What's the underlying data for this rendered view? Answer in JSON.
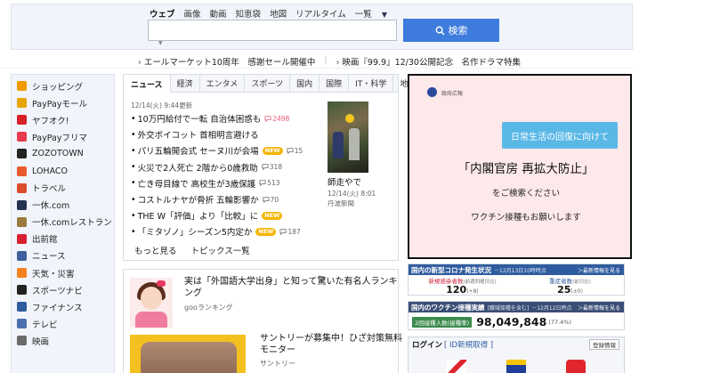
{
  "search": {
    "tabs": [
      "ウェブ",
      "画像",
      "動画",
      "知恵袋",
      "地図",
      "リアルタイム",
      "一覧"
    ],
    "button_label": "検索",
    "input_value": "",
    "input_placeholder": ""
  },
  "promos": [
    "エールマーケット10周年　感謝セール開催中",
    "映画『99.9』12/30公開記念　名作ドラマ特集"
  ],
  "sidebar": {
    "items": [
      {
        "label": "ショッピング",
        "icon": "cart-icon",
        "color": "#f39a00"
      },
      {
        "label": "PayPayモール",
        "icon": "bag-icon",
        "color": "#e8a400"
      },
      {
        "label": "ヤフオク!",
        "icon": "hammer-icon",
        "color": "#d92027"
      },
      {
        "label": "PayPayフリマ",
        "icon": "tag-icon",
        "color": "#e73a4e"
      },
      {
        "label": "ZOZOTOWN",
        "icon": "zozo-icon",
        "color": "#222222"
      },
      {
        "label": "LOHACO",
        "icon": "lohaco-icon",
        "color": "#e85a2e"
      },
      {
        "label": "トラベル",
        "icon": "suitcase-icon",
        "color": "#d94c2c"
      },
      {
        "label": "一休.com",
        "icon": "ikyu-icon",
        "color": "#24334f"
      },
      {
        "label": "一休.comレストラン",
        "icon": "restaurant-icon",
        "color": "#9b7b3d"
      },
      {
        "label": "出前館",
        "icon": "delivery-icon",
        "color": "#d81f30"
      },
      {
        "label": "ニュース",
        "icon": "news-icon",
        "color": "#3f5f9e"
      },
      {
        "label": "天気・災害",
        "icon": "weather-icon",
        "color": "#f58220"
      },
      {
        "label": "スポーツナビ",
        "icon": "sports-icon",
        "color": "#222222"
      },
      {
        "label": "ファイナンス",
        "icon": "finance-icon",
        "color": "#2f5c9e"
      },
      {
        "label": "テレビ",
        "icon": "tv-icon",
        "color": "#4a6fb0"
      },
      {
        "label": "映画",
        "icon": "movie-icon",
        "color": "#6b6b6b"
      }
    ]
  },
  "news": {
    "tabs": [
      "ニュース",
      "経済",
      "エンタメ",
      "スポーツ",
      "国内",
      "国際",
      "IT・科学",
      "地域"
    ],
    "timestamp": "12/14(火) 9:44更新",
    "items": [
      {
        "text": "10万円給付で一転 自治体困惑も",
        "comments": "2498",
        "hot": true,
        "new": false
      },
      {
        "text": "外交ボイコット 首相明言避ける",
        "comments": "",
        "hot": false,
        "new": false
      },
      {
        "text": "パリ五輪開会式 セーヌ川が会場",
        "comments": "15",
        "hot": false,
        "new": true
      },
      {
        "text": "火災で2人死亡 2階から0歳救助",
        "comments": "318",
        "hot": false,
        "new": false
      },
      {
        "text": "亡き母目線で 高校生が3歳保護",
        "comments": "513",
        "hot": false,
        "new": false
      },
      {
        "text": "コストルナヤが骨折 五輪影響か",
        "comments": "70",
        "hot": false,
        "new": false
      },
      {
        "text": "THE W「評価」より「比較」に",
        "comments": "",
        "hot": false,
        "new": true
      },
      {
        "text": "「ミタゾノ」シーズン5内定か",
        "comments": "187",
        "hot": false,
        "new": true
      }
    ],
    "new_label": "NEW",
    "more_label": "もっと見る",
    "topics_label": "トピックス一覧",
    "photo": {
      "title": "師走やで",
      "time": "12/14(火) 8:01",
      "source": "丹波新聞"
    }
  },
  "ad": {
    "logo_text": "政府広報",
    "pill": "日常生活の回復に向けて",
    "headline": "「内閣官房 再拡大防止」",
    "sub": "をご検索ください",
    "sub2": "ワクチン接種もお願いします"
  },
  "covid": {
    "title": "国内の新型コロナ発生状況",
    "date": "－12月13日10時時点",
    "more": "＞最新情報を見る",
    "new_label": "新規感染者数",
    "new_note": "(前週同曜日比)",
    "new_value": "120",
    "new_delta": "(+8)",
    "severe_label": "重症者数",
    "severe_note": "(前日比)",
    "severe_value": "25",
    "severe_delta": "(±0)"
  },
  "vaccine": {
    "title": "国内のワクチン接種実績",
    "note": "[職域接種を含む]",
    "date": "－12月12日時点",
    "more": "＞最新情報を見る",
    "label": "2回接種人数(接種率)",
    "value": "98,049,848",
    "pct": "(77.4%)"
  },
  "login": {
    "title": "ログイン",
    "sub": "[ ID新規取得 ]",
    "register": "登録情報"
  },
  "topics": [
    {
      "title": "実は「外国語大学出身」と知って驚いた有名人ランキング",
      "source": "gooランキング"
    },
    {
      "title": "サントリーが募集中！ひざ対策無料モニター",
      "source": "サントリー"
    }
  ]
}
